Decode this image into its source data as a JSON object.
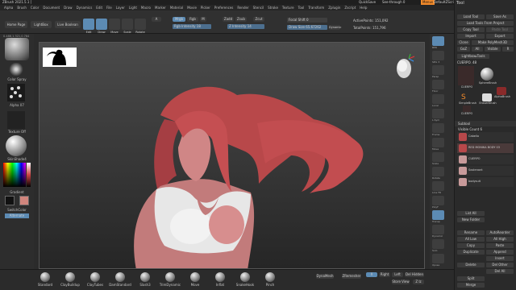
{
  "titlebar": {
    "app_title": "ZBrush 2021.5.1 [",
    "quicksave": "QuickSave",
    "see_through": "See-through 0",
    "menus": "Menus",
    "default_script": "DefaultZScript"
  },
  "menubar": {
    "items": [
      "Alpha",
      "Brush",
      "Color",
      "Document",
      "Draw",
      "Dynamics",
      "Edit",
      "File",
      "Layer",
      "Light",
      "Macro",
      "Marker",
      "Material",
      "Movie",
      "Picker",
      "Preferences",
      "Render",
      "Stencil",
      "Stroke",
      "Texture",
      "Tool",
      "Transform",
      "Zplugin",
      "Zscript",
      "Help"
    ]
  },
  "toolbar": {
    "home_page": "Home Page",
    "lightbox": "LightBox",
    "live_boolean": "Live Boolean",
    "edit": "Edit",
    "draw": "Draw",
    "move": "Move",
    "scale": "Scale",
    "rotate": "Rotate",
    "mrgb": "Mrgb",
    "rgb": "Rgb",
    "m": "M",
    "zadd": "Zadd",
    "zsub": "Zsub",
    "zcut": "Zcut",
    "rgb_intensity": "Rgb Intensity 18",
    "z_intensity": "Z Intensity 14",
    "focal_shift": "Focal Shift 0",
    "draw_size": "Draw Size 65.67262",
    "dynamic": "Dynamic",
    "active_points": "ActivePoints: 151,092",
    "total_points": "TotalPoints: 151,796"
  },
  "lefttray": {
    "coords": "0.488,1.321,0.784",
    "alpha": "Alpha Off",
    "color_spray": "Color Spray",
    "alpha_07": "Alpha 07",
    "texture": "Texture Off",
    "material": "SkinShade4",
    "gradient": "Gradient",
    "switch_color": "SwitchColor",
    "alternate": "Alternate"
  },
  "rightshelf": {
    "buttons": [
      "BPR",
      "SPix 3",
      "Persp",
      "Floor",
      "Local",
      "L.Sym",
      "Frame",
      "Move",
      "Scale",
      "Rotate",
      "Line Fill",
      "PolyF",
      "Transp",
      "Dynamic",
      "Solo",
      "Xpose"
    ]
  },
  "palette": {
    "title": "Tool",
    "load_tool": "Load Tool",
    "save_as": "Save As",
    "load_tools_from_project": "Load Tools From Project",
    "copy_tool": "Copy Tool",
    "paste_tool": "Paste Tool",
    "import": "Import",
    "export": "Export",
    "clone": "Clone",
    "make_polymesh": "Make PolyMesh3D",
    "goz": "GoZ",
    "all": "All",
    "visible": "Visible",
    "r": "R",
    "lightbox_tools": "Lightbox▸Tools",
    "current_tool": "CUERPO. 48",
    "tool_items": [
      "CUERPO",
      "SphereBrush",
      "AlphaBrush",
      "SimpleBrush",
      "EraserBrush",
      "CUERPO"
    ],
    "subtool_header": "Subtool",
    "visible_count": "Visible Count 6",
    "subtools": [
      "Cabello",
      "RED MONIKA BODY 03",
      "CUERPO",
      "Sostenant",
      "bodysuit"
    ],
    "list_all": "List All",
    "new_folder": "New Folder",
    "rename": "Rename",
    "autoreorder": "AutoReorder",
    "all_low": "All Low",
    "all_high": "All High",
    "copy": "Copy",
    "paste": "Paste",
    "duplicate": "Duplicate",
    "append": "Append",
    "insert": "Insert",
    "delete": "Delete",
    "del_other": "Del Other",
    "del_all": "Del All",
    "split": "Split",
    "merge": "Merge"
  },
  "bottom": {
    "brushes": [
      "Standard",
      "ClayBuildup",
      "ClayTubes",
      "DamStandard",
      "Slash3",
      "TrimDynamic",
      "Move",
      "Inflat",
      "SnakeHook",
      "Pinch"
    ],
    "dynamesh": "DynaMesh",
    "zremesher": "ZRemesher",
    "store_view": "Store View",
    "sym_x": "X",
    "right": "Right",
    "left": "Left",
    "del_hidden": "Del Hidden",
    "ziz": "Z Iz"
  },
  "colors": {
    "accent": "#f28a2a",
    "active_blue": "#5c8bb4",
    "hair": "#c44a4a",
    "skin": "#c97c7c",
    "suit": "#e6e6e6"
  }
}
